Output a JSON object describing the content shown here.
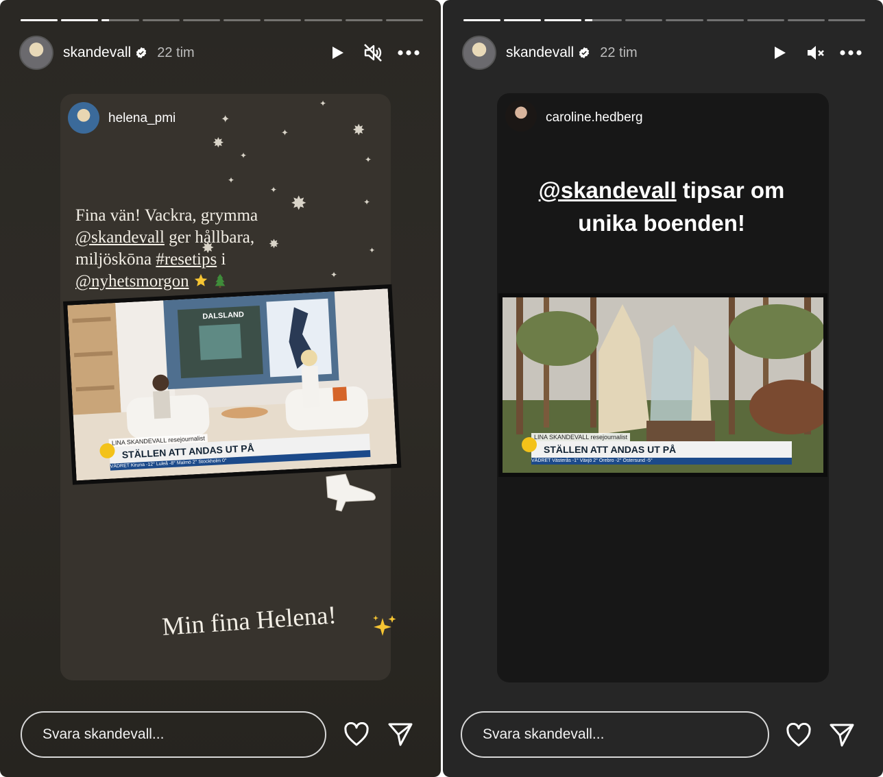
{
  "stories": [
    {
      "progress": [
        1,
        1,
        0.2,
        0,
        0,
        0,
        0,
        0,
        0,
        0
      ],
      "author": {
        "username": "skandevall",
        "time": "22 tim"
      },
      "reshared_user": "helena_pmi",
      "text": {
        "line1": "Fina vän! Vackra, grymma",
        "mention1": "@skandevall",
        "line2": " ger hållbara,",
        "line3": "miljöskōna ",
        "hashtag": "#resetips",
        "line3b": " i",
        "mention2": "@nyhetsmorgon"
      },
      "tv": {
        "map_label": "DALSLAND",
        "lower_third_name": "LINA SKANDEVALL resejournalist",
        "lower_third_title": "STÄLLEN ATT ANDAS UT PÅ",
        "weather": "VÄDRET   Kiruna -12°   Luleå -8°   Malmö 2°   Stockholm 0°",
        "channel": "4"
      },
      "caption": "Min fina Helena!",
      "reply_placeholder": "Svara skandevall...",
      "icons": [
        "play-icon",
        "muted-speaker-icon",
        "more-icon",
        "heart-icon",
        "send-icon"
      ]
    },
    {
      "progress": [
        1,
        1,
        1,
        0.2,
        0,
        0,
        0,
        0,
        0,
        0
      ],
      "author": {
        "username": "skandevall",
        "time": "22 tim"
      },
      "reshared_user": "caroline.hedberg",
      "headline": {
        "mention": "@skandevall",
        "rest1": " tipsar om",
        "rest2": "unika boenden!"
      },
      "tv": {
        "lower_third_name": "LINA SKANDEVALL resejournalist",
        "lower_third_title": "STÄLLEN ATT ANDAS UT PÅ",
        "weather": "VÄDRET   Västerås -1°   Växjö 2°   Örebro -2°   Östersund -5°",
        "channel": "4"
      },
      "reply_placeholder": "Svara skandevall...",
      "icons": [
        "play-icon",
        "muted-speaker-icon",
        "more-icon",
        "heart-icon",
        "send-icon"
      ]
    }
  ],
  "colors": {
    "background": "#262626",
    "text": "#ffffff",
    "card1": "#37332d",
    "card2": "#171717"
  }
}
